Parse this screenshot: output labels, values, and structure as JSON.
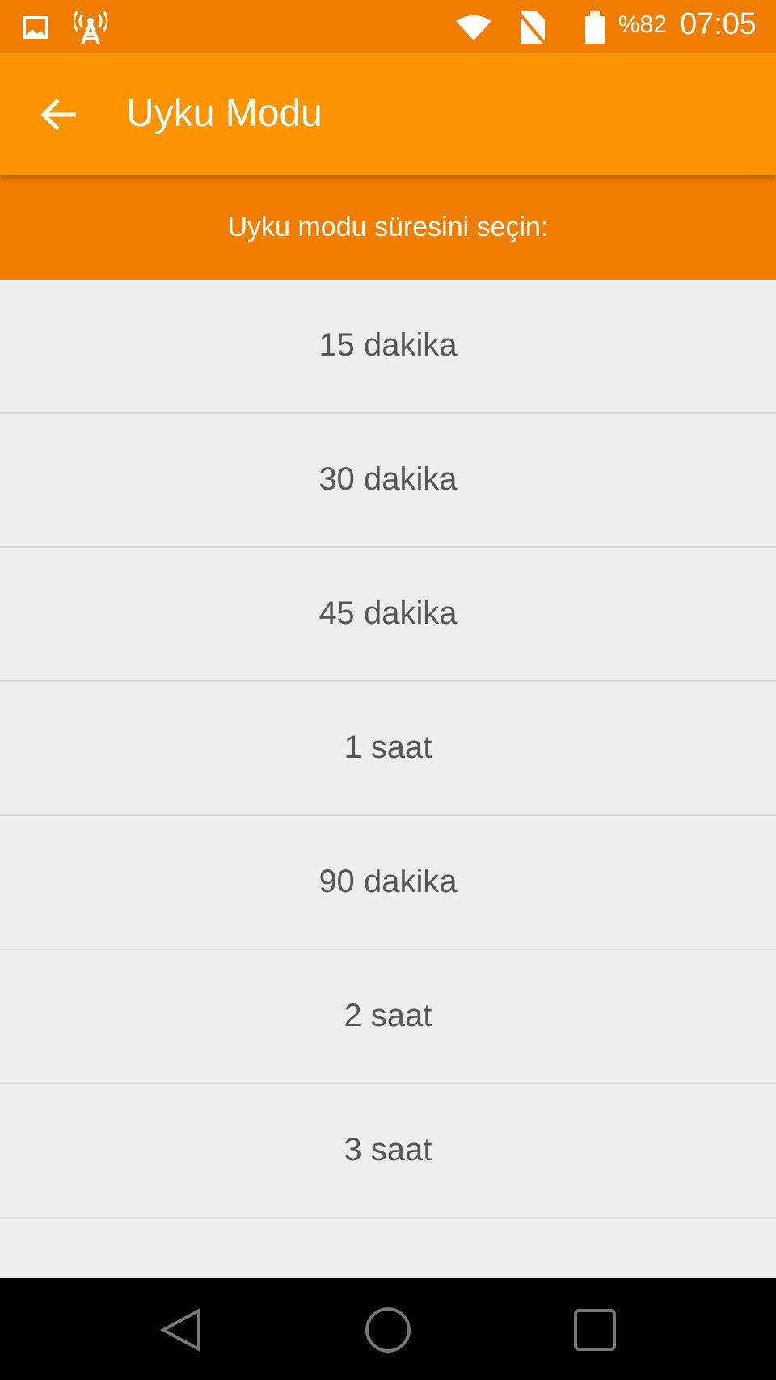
{
  "status_bar": {
    "battery": "%82",
    "time": "07:05"
  },
  "toolbar": {
    "title": "Uyku Modu"
  },
  "prompt": "Uyku modu süresini seçin:",
  "options": [
    {
      "label": "15 dakika"
    },
    {
      "label": "30 dakika"
    },
    {
      "label": "45 dakika"
    },
    {
      "label": "1 saat"
    },
    {
      "label": "90 dakika"
    },
    {
      "label": "2 saat"
    },
    {
      "label": "3 saat"
    }
  ]
}
